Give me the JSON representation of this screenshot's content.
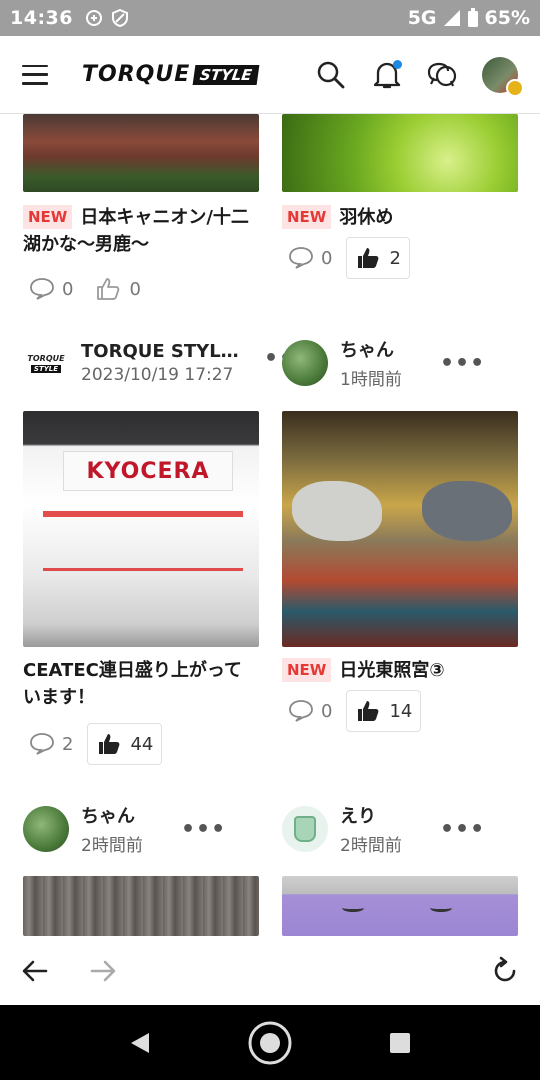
{
  "status_bar": {
    "time": "14:36",
    "network": "5G",
    "battery": "65%"
  },
  "header": {
    "logo_main": "TORQUE",
    "logo_sub": "STYLE",
    "icons": [
      "menu-icon",
      "search-icon",
      "bell-icon",
      "chat-icon",
      "profile-avatar"
    ]
  },
  "posts": [
    {
      "title": "日本キャニオン/十二湖かな〜男鹿〜",
      "new_label": "NEW",
      "comments": "0",
      "likes": "0"
    },
    {
      "title": "羽休め",
      "new_label": "NEW",
      "comments": "0",
      "likes": "2"
    },
    {
      "author": "TORQUE STYL…",
      "time": "2023/10/19 17:27",
      "more": "•••",
      "image_text": "KYOCERA",
      "title": "CEATEC連日盛り上がっています！",
      "comments": "2",
      "likes": "44"
    },
    {
      "author": "ちゃん",
      "time": "1時間前",
      "more": "•••",
      "title": "日光東照宮③",
      "new_label": "NEW",
      "comments": "0",
      "likes": "14"
    },
    {
      "author": "ちゃん",
      "time": "2時間前",
      "more": "•••"
    },
    {
      "author": "えり",
      "time": "2時間前",
      "more": "•••"
    }
  ],
  "browser_nav": {
    "icons": [
      "back-arrow-icon",
      "forward-arrow-icon",
      "reload-icon"
    ]
  },
  "colors": {
    "accent_new": "#e53935",
    "notification_dot": "#1e88e5",
    "status_bar": "#9e9e9e"
  }
}
